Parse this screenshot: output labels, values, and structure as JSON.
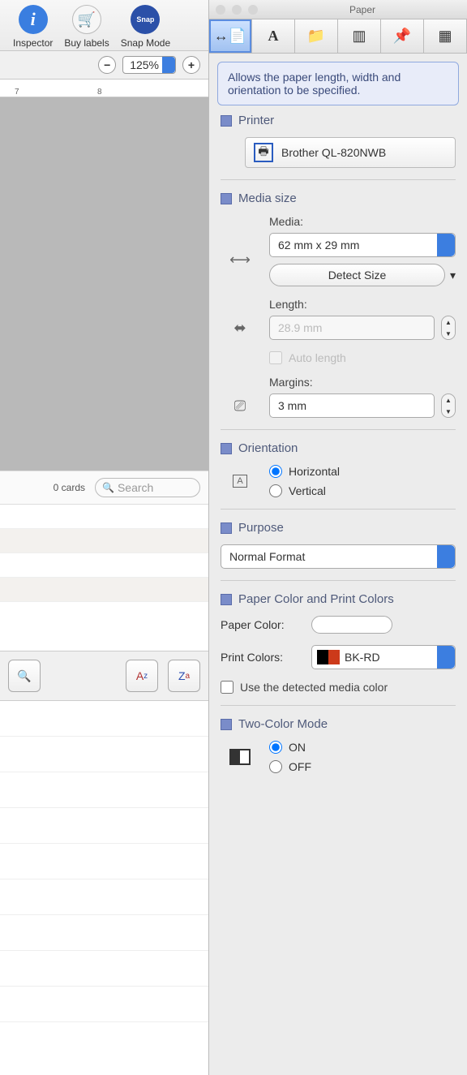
{
  "left": {
    "toolbar": {
      "inspector": "Inspector",
      "buy": "Buy labels",
      "snap": "Snap Mode"
    },
    "zoom": {
      "value": "125%"
    },
    "ruler": {
      "mark7": "7",
      "mark8": "8"
    },
    "cards_count": "0 cards",
    "search_placeholder": "Search"
  },
  "right": {
    "window_title": "Paper",
    "description": "Allows the paper length, width and orientation to be specified.",
    "printer": {
      "label": "Printer",
      "name": "Brother QL-820NWB"
    },
    "media_size": {
      "label": "Media size",
      "media_lbl": "Media:",
      "media_value": "62 mm x 29 mm",
      "detect": "Detect Size",
      "length_lbl": "Length:",
      "length_value": "28.9 mm",
      "auto_length": "Auto length",
      "margins_lbl": "Margins:",
      "margins_value": "3 mm"
    },
    "orientation": {
      "label": "Orientation",
      "h": "Horizontal",
      "v": "Vertical"
    },
    "purpose": {
      "label": "Purpose",
      "value": "Normal Format"
    },
    "colors": {
      "label": "Paper Color and Print Colors",
      "paper_lbl": "Paper Color:",
      "print_lbl": "Print Colors:",
      "print_value": "BK-RD",
      "detected": "Use the detected media color"
    },
    "twocolor": {
      "label": "Two-Color Mode",
      "on": "ON",
      "off": "OFF"
    }
  }
}
